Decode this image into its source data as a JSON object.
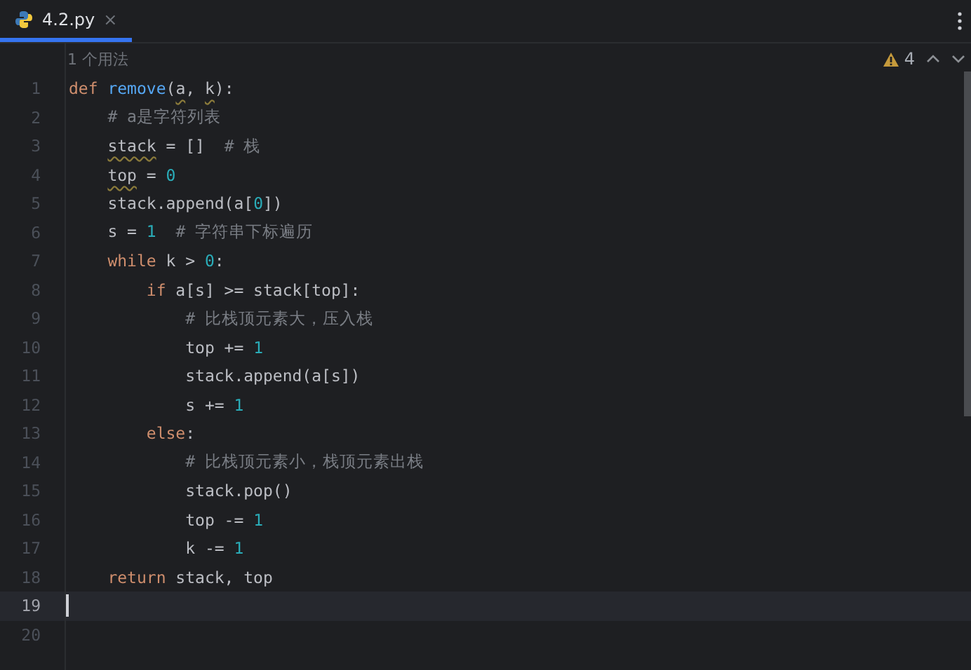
{
  "tabs": [
    {
      "label": "4.2.py",
      "selected": true,
      "close": "×"
    }
  ],
  "editor": {
    "usage_hint": "1 个用法",
    "warnings": "4",
    "lines": [
      {
        "number": "1",
        "current": false,
        "tokens": [
          {
            "kind": "keyword",
            "text": "def "
          },
          {
            "kind": "function",
            "text": "remove"
          },
          {
            "kind": "plain",
            "text": "("
          },
          {
            "kind": "warn",
            "text": "a"
          },
          {
            "kind": "plain",
            "text": ", "
          },
          {
            "kind": "warn",
            "text": "k"
          },
          {
            "kind": "plain",
            "text": "):"
          }
        ]
      },
      {
        "number": "2",
        "current": false,
        "tokens": [
          {
            "kind": "comment",
            "text": "    # a是字符列表"
          }
        ]
      },
      {
        "number": "3",
        "current": false,
        "tokens": [
          {
            "kind": "warn",
            "text": "    stack"
          },
          {
            "kind": "plain",
            "text": " = []  "
          },
          {
            "kind": "comment",
            "text": "# 栈"
          }
        ]
      },
      {
        "number": "4",
        "current": false,
        "tokens": [
          {
            "kind": "warn",
            "text": "    top"
          },
          {
            "kind": "plain",
            "text": " = "
          },
          {
            "kind": "number",
            "text": "0"
          }
        ]
      },
      {
        "number": "5",
        "current": false,
        "tokens": [
          {
            "kind": "plain",
            "text": "    stack.append(a["
          },
          {
            "kind": "number",
            "text": "0"
          },
          {
            "kind": "plain",
            "text": "])"
          }
        ]
      },
      {
        "number": "6",
        "current": false,
        "tokens": [
          {
            "kind": "plain",
            "text": "    s = "
          },
          {
            "kind": "number",
            "text": "1"
          },
          {
            "kind": "comment",
            "text": "  # 字符串下标遍历"
          }
        ]
      },
      {
        "number": "7",
        "current": false,
        "tokens": [
          {
            "kind": "keyword",
            "text": "    while "
          },
          {
            "kind": "plain",
            "text": "k > "
          },
          {
            "kind": "number",
            "text": "0"
          },
          {
            "kind": "plain",
            "text": ":"
          }
        ]
      },
      {
        "number": "8",
        "current": false,
        "tokens": [
          {
            "kind": "keyword",
            "text": "        if "
          },
          {
            "kind": "plain",
            "text": "a[s] >= stack[top]:"
          }
        ]
      },
      {
        "number": "9",
        "current": false,
        "tokens": [
          {
            "kind": "comment",
            "text": "            # 比栈顶元素大，压入栈"
          }
        ]
      },
      {
        "number": "10",
        "current": false,
        "tokens": [
          {
            "kind": "plain",
            "text": "            top += "
          },
          {
            "kind": "number",
            "text": "1"
          }
        ]
      },
      {
        "number": "11",
        "current": false,
        "tokens": [
          {
            "kind": "plain",
            "text": "            stack.append(a[s])"
          }
        ]
      },
      {
        "number": "12",
        "current": false,
        "tokens": [
          {
            "kind": "plain",
            "text": "            s += "
          },
          {
            "kind": "number",
            "text": "1"
          }
        ]
      },
      {
        "number": "13",
        "current": false,
        "tokens": [
          {
            "kind": "keyword",
            "text": "        else"
          },
          {
            "kind": "plain",
            "text": ":"
          }
        ]
      },
      {
        "number": "14",
        "current": false,
        "tokens": [
          {
            "kind": "comment",
            "text": "            # 比栈顶元素小，栈顶元素出栈"
          }
        ]
      },
      {
        "number": "15",
        "current": false,
        "tokens": [
          {
            "kind": "plain",
            "text": "            stack.pop()"
          }
        ]
      },
      {
        "number": "16",
        "current": false,
        "tokens": [
          {
            "kind": "plain",
            "text": "            top -= "
          },
          {
            "kind": "number",
            "text": "1"
          }
        ]
      },
      {
        "number": "17",
        "current": false,
        "tokens": [
          {
            "kind": "plain",
            "text": "            k -= "
          },
          {
            "kind": "number",
            "text": "1"
          }
        ]
      },
      {
        "number": "18",
        "current": false,
        "tokens": [
          {
            "kind": "keyword",
            "text": "    return "
          },
          {
            "kind": "plain",
            "text": "stack, top"
          }
        ]
      },
      {
        "number": "19",
        "current": true
      },
      {
        "number": "20",
        "current": false
      }
    ]
  }
}
